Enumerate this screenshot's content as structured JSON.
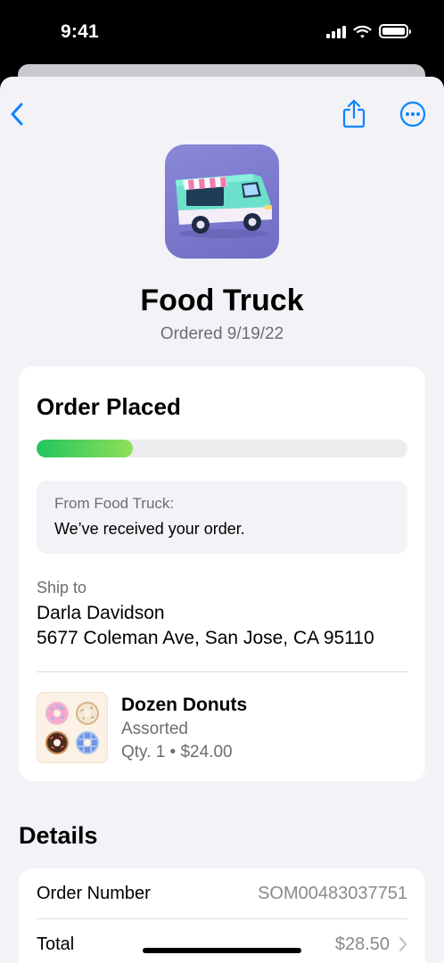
{
  "status_bar": {
    "time": "9:41"
  },
  "app": {
    "name": "Food Truck",
    "ordered": "Ordered 9/19/22"
  },
  "order": {
    "status_title": "Order Placed",
    "progress": 0.26,
    "message_from": "From Food Truck:",
    "message_text": "We’ve received your order.",
    "ship_to_label": "Ship to",
    "ship_name": "Darla Davidson",
    "ship_address": "5677 Coleman Ave, San Jose, CA 95110",
    "item": {
      "name": "Dozen Donuts",
      "variant": "Assorted",
      "qty_price": "Qty. 1 • $24.00"
    }
  },
  "details": {
    "title": "Details",
    "rows": [
      {
        "label": "Order Number",
        "value": "SOM00483037751"
      },
      {
        "label": "Total",
        "value": "$28.50"
      }
    ]
  },
  "icons": {
    "back": "chevron-left-icon",
    "share": "share-icon",
    "more": "ellipsis-circle-icon",
    "row_chevron": "chevron-right-icon"
  },
  "colors": {
    "accent": "#0a84ff",
    "progress_start": "#23c45e",
    "progress_end": "#8ee05a",
    "app_icon_bg": "#7c7ace"
  }
}
